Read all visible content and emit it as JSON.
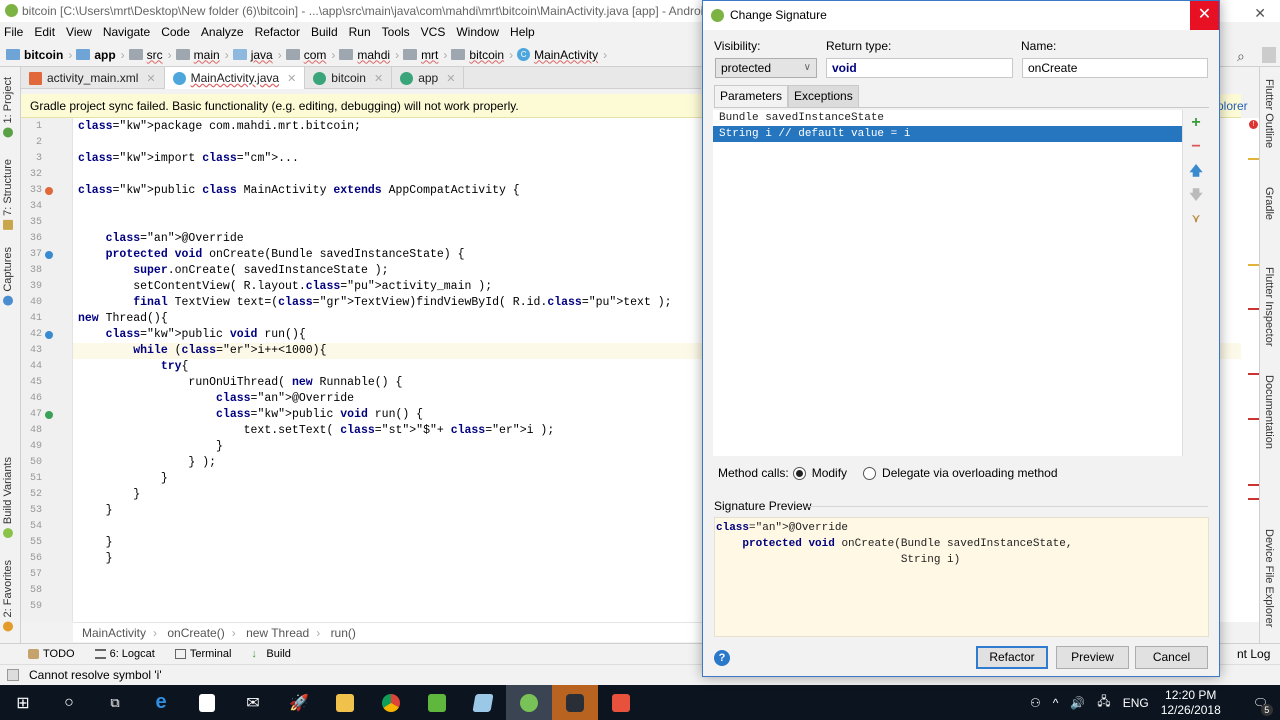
{
  "window": {
    "title": "bitcoin [C:\\Users\\mrt\\Desktop\\New folder (6)\\bitcoin] - ...\\app\\src\\main\\java\\com\\mahdi\\mrt\\bitcoin\\MainActivity.java [app] - Android Studio"
  },
  "menu": [
    "File",
    "Edit",
    "View",
    "Navigate",
    "Code",
    "Analyze",
    "Refactor",
    "Build",
    "Run",
    "Tools",
    "VCS",
    "Window",
    "Help"
  ],
  "nav_breadcrumb": [
    "bitcoin",
    "app",
    "src",
    "main",
    "java",
    "com",
    "mahdi",
    "mrt",
    "bitcoin",
    "MainActivity"
  ],
  "editor_tabs": [
    {
      "label": "activity_main.xml",
      "active": false
    },
    {
      "label": "MainActivity.java",
      "active": true
    },
    {
      "label": "bitcoin",
      "active": false
    },
    {
      "label": "app",
      "active": false
    }
  ],
  "banner": {
    "text": "Gradle project sync failed. Basic functionality (e.g. editing, debugging) will not work properly.",
    "link_partial": "plorer"
  },
  "left_tool_tabs": [
    "1: Project",
    "7: Structure",
    "Captures",
    "Build Variants",
    "2: Favorites"
  ],
  "right_tool_tabs": [
    "Flutter Outline",
    "Gradle",
    "Flutter Inspector",
    "Documentation",
    "Device File Explorer"
  ],
  "code_lines": [
    {
      "n": "1",
      "t": "package com.mahdi.mrt.bitcoin;"
    },
    {
      "n": "2",
      "t": ""
    },
    {
      "n": "3",
      "t": "import ..."
    },
    {
      "n": "32",
      "t": ""
    },
    {
      "n": "33",
      "t": "public class MainActivity extends AppCompatActivity {"
    },
    {
      "n": "34",
      "t": ""
    },
    {
      "n": "35",
      "t": ""
    },
    {
      "n": "36",
      "t": "    @Override"
    },
    {
      "n": "37",
      "t": "    protected void onCreate(Bundle savedInstanceState) {"
    },
    {
      "n": "38",
      "t": "        super.onCreate( savedInstanceState );"
    },
    {
      "n": "39",
      "t": "        setContentView( R.layout.activity_main );"
    },
    {
      "n": "40",
      "t": "        final TextView text=(TextView)findViewById( R.id.text );"
    },
    {
      "n": "41",
      "t": "new Thread(){"
    },
    {
      "n": "42",
      "t": "    public void run(){"
    },
    {
      "n": "43",
      "t": "        while (i++<1000){"
    },
    {
      "n": "44",
      "t": "            try{"
    },
    {
      "n": "45",
      "t": "                runOnUiThread( new Runnable() {"
    },
    {
      "n": "46",
      "t": "                    @Override"
    },
    {
      "n": "47",
      "t": "                    public void run() {"
    },
    {
      "n": "48",
      "t": "                        text.setText( \"$\"+ i );"
    },
    {
      "n": "49",
      "t": "                    }"
    },
    {
      "n": "50",
      "t": "                } );"
    },
    {
      "n": "51",
      "t": "            }"
    },
    {
      "n": "52",
      "t": "        }"
    },
    {
      "n": "53",
      "t": "    }"
    },
    {
      "n": "54",
      "t": ""
    },
    {
      "n": "55",
      "t": "    }"
    },
    {
      "n": "56",
      "t": "    }"
    },
    {
      "n": "57",
      "t": ""
    },
    {
      "n": "58",
      "t": ""
    },
    {
      "n": "59",
      "t": ""
    }
  ],
  "code_breadcrumb": [
    "MainActivity",
    "onCreate()",
    "new Thread",
    "run()"
  ],
  "tool_windows": [
    "TODO",
    "6: Logcat",
    "Terminal",
    "Build"
  ],
  "event_log_partial": "nt Log",
  "status_message": "Cannot resolve symbol 'i'",
  "dialog": {
    "title": "Change Signature",
    "visibility_label": "Visibility:",
    "visibility_value": "protected",
    "return_type_label": "Return type:",
    "return_type_value": "void",
    "name_label": "Name:",
    "name_value": "onCreate",
    "tabs": [
      "Parameters",
      "Exceptions"
    ],
    "parameters": [
      {
        "text": "Bundle savedInstanceState",
        "selected": false
      },
      {
        "text": "String i // default value = i",
        "selected": true
      }
    ],
    "param_tools": [
      "add-icon",
      "remove-icon",
      "move-up-icon",
      "move-down-icon",
      "propagate-icon"
    ],
    "method_calls_label": "Method calls:",
    "method_calls_options": [
      {
        "label": "Modify",
        "checked": true
      },
      {
        "label": "Delegate via overloading method",
        "checked": false
      }
    ],
    "signature_preview_label": "Signature Preview",
    "signature_preview": "@Override\n    protected void onCreate(Bundle savedInstanceState,\n                            String i)",
    "buttons": {
      "refactor": "Refactor",
      "preview": "Preview",
      "cancel": "Cancel"
    }
  },
  "taskbar": {
    "apps": [
      "start",
      "cortana",
      "task-view",
      "edge",
      "store",
      "mail",
      "rocket",
      "file-explorer",
      "chrome",
      "camtasia-recorder",
      "notepad",
      "android-studio",
      "nox",
      "camtasia"
    ],
    "active": "android-studio",
    "tray": {
      "language": "ENG",
      "time": "12:20 PM",
      "date": "12/26/2018",
      "notifications": "5"
    }
  }
}
